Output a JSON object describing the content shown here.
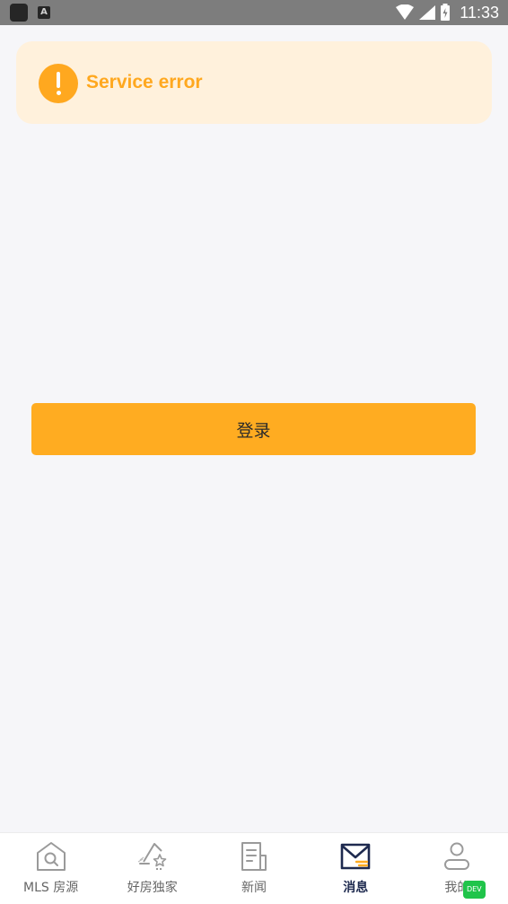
{
  "status_bar": {
    "time": "11:33",
    "app_icon_letter": "A",
    "icons": [
      "app-icon",
      "a-notification-icon",
      "wifi-icon",
      "cell-signal-icon",
      "battery-icon"
    ]
  },
  "error_toast": {
    "message": "Service error",
    "icon": "exclamation-circle-icon",
    "color": "#ffa81f",
    "background": "#fff1dc"
  },
  "login_button": {
    "label": "登录",
    "color": "#ffac21"
  },
  "tab_bar": {
    "active_tab": "消息",
    "tabs": [
      {
        "label": "MLS 房源",
        "icon": "house-search-icon"
      },
      {
        "label": "好房独家",
        "icon": "house-star-icon"
      },
      {
        "label": "新闻",
        "icon": "newspaper-icon"
      },
      {
        "label": "消息",
        "icon": "envelope-icon"
      },
      {
        "label": "我的",
        "icon": "person-icon"
      }
    ],
    "badge": "DEV",
    "active_color": "#1e2a4f",
    "badge_color": "#20c44a"
  }
}
